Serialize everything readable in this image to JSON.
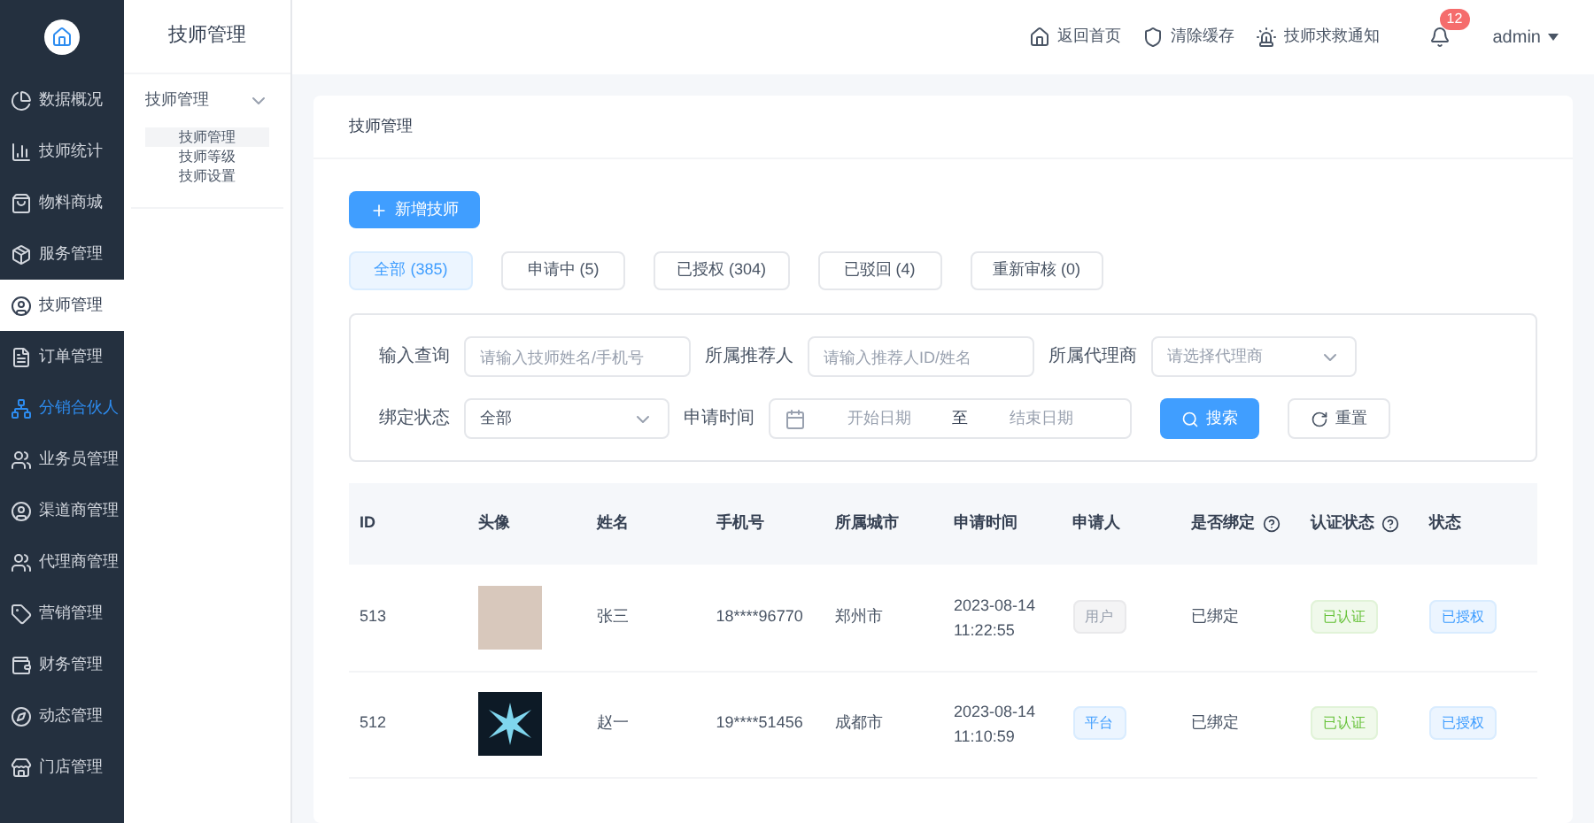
{
  "sidebar": {
    "items": [
      {
        "label": "数据概况",
        "selected": false,
        "highlighted": false
      },
      {
        "label": "技师统计",
        "selected": false,
        "highlighted": false
      },
      {
        "label": "物料商城",
        "selected": false,
        "highlighted": false
      },
      {
        "label": "服务管理",
        "selected": false,
        "highlighted": false
      },
      {
        "label": "技师管理",
        "selected": true,
        "highlighted": false
      },
      {
        "label": "订单管理",
        "selected": false,
        "highlighted": false
      },
      {
        "label": "分销合伙人",
        "selected": false,
        "highlighted": true
      },
      {
        "label": "业务员管理",
        "selected": false,
        "highlighted": false
      },
      {
        "label": "渠道商管理",
        "selected": false,
        "highlighted": false
      },
      {
        "label": "代理商管理",
        "selected": false,
        "highlighted": false
      },
      {
        "label": "营销管理",
        "selected": false,
        "highlighted": false
      },
      {
        "label": "财务管理",
        "selected": false,
        "highlighted": false
      },
      {
        "label": "动态管理",
        "selected": false,
        "highlighted": false
      },
      {
        "label": "门店管理",
        "selected": false,
        "highlighted": false
      }
    ]
  },
  "submenu": {
    "title": "技师管理",
    "group": {
      "label": "技师管理",
      "expanded": true,
      "children": [
        {
          "label": "技师管理",
          "selected": true
        },
        {
          "label": "技师等级",
          "selected": false
        },
        {
          "label": "技师设置",
          "selected": false
        }
      ]
    }
  },
  "header": {
    "links": [
      {
        "label": "返回首页"
      },
      {
        "label": "清除缓存"
      },
      {
        "label": "技师求救通知"
      }
    ],
    "badge": "12",
    "user": "admin"
  },
  "page": {
    "title": "技师管理",
    "add_button": "新增技师",
    "tabs": [
      {
        "label": "全部 (385)",
        "selected": true
      },
      {
        "label": "申请中 (5)",
        "selected": false
      },
      {
        "label": "已授权 (304)",
        "selected": false
      },
      {
        "label": "已驳回 (4)",
        "selected": false
      },
      {
        "label": "重新审核 (0)",
        "selected": false
      }
    ],
    "filters": {
      "query": {
        "label": "输入查询",
        "placeholder": "请输入技师姓名/手机号"
      },
      "referrer": {
        "label": "所属推荐人",
        "placeholder": "请输入推荐人ID/姓名"
      },
      "agent": {
        "label": "所属代理商",
        "placeholder": "请选择代理商"
      },
      "bind": {
        "label": "绑定状态",
        "value": "全部"
      },
      "date": {
        "label": "申请时间",
        "start": "开始日期",
        "separator": "至",
        "end": "结束日期"
      },
      "search": "搜索",
      "reset": "重置"
    },
    "table": {
      "columns": [
        {
          "label": "ID",
          "help": false
        },
        {
          "label": "头像",
          "help": false
        },
        {
          "label": "姓名",
          "help": false
        },
        {
          "label": "手机号",
          "help": false
        },
        {
          "label": "所属城市",
          "help": false
        },
        {
          "label": "申请时间",
          "help": false
        },
        {
          "label": "申请人",
          "help": false
        },
        {
          "label": "是否绑定",
          "help": true
        },
        {
          "label": "认证状态",
          "help": true
        },
        {
          "label": "状态",
          "help": false
        }
      ],
      "rows": [
        {
          "id": "513",
          "name": "张三",
          "phone": "18****96770",
          "city": "郑州市",
          "date": "2023-08-14",
          "time": "11:22:55",
          "applicant": {
            "label": "用户",
            "kind": "user"
          },
          "bind": "已绑定",
          "cert": "已认证",
          "status": "已授权"
        },
        {
          "id": "512",
          "name": "赵一",
          "phone": "19****51456",
          "city": "成都市",
          "date": "2023-08-14",
          "time": "11:10:59",
          "applicant": {
            "label": "平台",
            "kind": "platform"
          },
          "bind": "已绑定",
          "cert": "已认证",
          "status": "已授权"
        }
      ]
    }
  }
}
